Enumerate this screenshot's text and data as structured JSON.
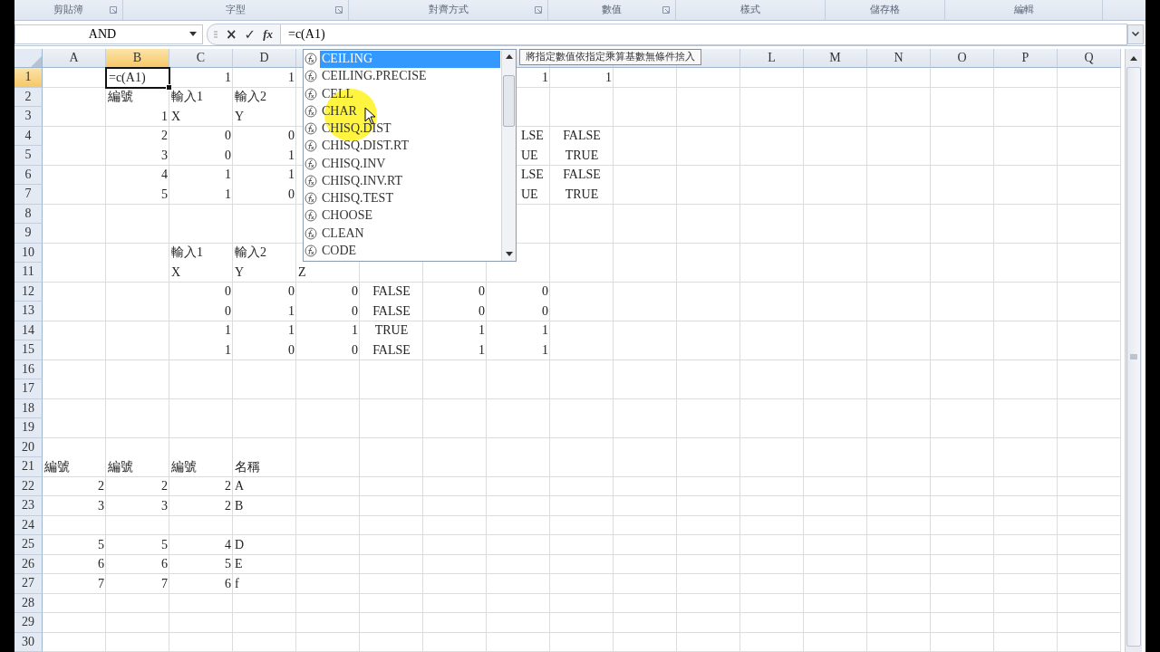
{
  "ribbon_groups": [
    {
      "label": "剪貼簿",
      "launcher": true
    },
    {
      "label": "字型",
      "launcher": true
    },
    {
      "label": "對齊方式",
      "launcher": true
    },
    {
      "label": "數值",
      "launcher": true
    },
    {
      "label": "樣式",
      "launcher": false
    },
    {
      "label": "儲存格",
      "launcher": false
    },
    {
      "label": "編輯",
      "launcher": false
    }
  ],
  "formula_bar": {
    "name_box": "AND",
    "cancel": "×",
    "enter": "✓",
    "fx": "fx",
    "formula": "=c(A1)"
  },
  "column_headers_left": [
    {
      "label": "A",
      "selected": false
    },
    {
      "label": "B",
      "selected": true
    },
    {
      "label": "C",
      "selected": false
    },
    {
      "label": "D",
      "selected": false
    }
  ],
  "column_headers_right": [
    {
      "label": "L",
      "selected": false
    },
    {
      "label": "M",
      "selected": false
    },
    {
      "label": "N",
      "selected": false
    },
    {
      "label": "O",
      "selected": false
    },
    {
      "label": "P",
      "selected": false
    },
    {
      "label": "Q",
      "selected": false
    }
  ],
  "rows": [
    {
      "header": "1",
      "selected": true,
      "cells": [
        null,
        {
          "text": "=c(A1)",
          "kind": "text",
          "selected": true
        },
        {
          "text": "1",
          "kind": "number",
          "selected": false
        },
        {
          "text": "1",
          "kind": "number",
          "selected": false
        },
        null,
        null,
        null,
        {
          "text": "1",
          "kind": "number",
          "selected": false
        },
        {
          "text": "1",
          "kind": "number",
          "selected": false
        }
      ]
    },
    {
      "header": "2",
      "selected": false,
      "cells": [
        null,
        {
          "text": "編號",
          "kind": "text",
          "selected": false
        },
        {
          "text": "輸入1",
          "kind": "text",
          "selected": false
        },
        {
          "text": "輸入2",
          "kind": "text",
          "selected": false
        }
      ]
    },
    {
      "header": "3",
      "selected": false,
      "cells": [
        null,
        {
          "text": "1",
          "kind": "number",
          "selected": false
        },
        {
          "text": "X",
          "kind": "text",
          "selected": false
        },
        {
          "text": "Y",
          "kind": "text",
          "selected": false
        }
      ]
    },
    {
      "header": "4",
      "selected": false,
      "cells": [
        null,
        {
          "text": "2",
          "kind": "number",
          "selected": false
        },
        {
          "text": "0",
          "kind": "number",
          "selected": false
        },
        {
          "text": "0",
          "kind": "number",
          "selected": false
        },
        null,
        null,
        null,
        {
          "text": "LSE",
          "kind": "partial",
          "selected": false
        },
        {
          "text": "FALSE",
          "kind": "bool",
          "selected": false
        }
      ]
    },
    {
      "header": "5",
      "selected": false,
      "cells": [
        null,
        {
          "text": "3",
          "kind": "number",
          "selected": false
        },
        {
          "text": "0",
          "kind": "number",
          "selected": false
        },
        {
          "text": "1",
          "kind": "number",
          "selected": false
        },
        null,
        null,
        null,
        {
          "text": "UE",
          "kind": "partial",
          "selected": false
        },
        {
          "text": "TRUE",
          "kind": "bool",
          "selected": false
        }
      ]
    },
    {
      "header": "6",
      "selected": false,
      "cells": [
        null,
        {
          "text": "4",
          "kind": "number",
          "selected": false
        },
        {
          "text": "1",
          "kind": "number",
          "selected": false
        },
        {
          "text": "1",
          "kind": "number",
          "selected": false
        },
        null,
        null,
        null,
        {
          "text": "LSE",
          "kind": "partial",
          "selected": false
        },
        {
          "text": "FALSE",
          "kind": "bool",
          "selected": false
        }
      ]
    },
    {
      "header": "7",
      "selected": false,
      "cells": [
        null,
        {
          "text": "5",
          "kind": "number",
          "selected": false
        },
        {
          "text": "1",
          "kind": "number",
          "selected": false
        },
        {
          "text": "0",
          "kind": "number",
          "selected": false
        },
        null,
        null,
        null,
        {
          "text": "UE",
          "kind": "partial",
          "selected": false
        },
        {
          "text": "TRUE",
          "kind": "bool",
          "selected": false
        }
      ]
    },
    {
      "header": "8",
      "selected": false,
      "cells": []
    },
    {
      "header": "9",
      "selected": false,
      "cells": []
    },
    {
      "header": "10",
      "selected": false,
      "cells": [
        null,
        null,
        {
          "text": "輸入1",
          "kind": "text",
          "selected": false
        },
        {
          "text": "輸入2",
          "kind": "text",
          "selected": false
        }
      ]
    },
    {
      "header": "11",
      "selected": false,
      "cells": [
        null,
        null,
        {
          "text": "X",
          "kind": "text",
          "selected": false
        },
        {
          "text": "Y",
          "kind": "text",
          "selected": false
        },
        {
          "text": "Z",
          "kind": "text",
          "selected": false
        }
      ]
    },
    {
      "header": "12",
      "selected": false,
      "cells": [
        null,
        null,
        {
          "text": "0",
          "kind": "number",
          "selected": false
        },
        {
          "text": "0",
          "kind": "number",
          "selected": false
        },
        {
          "text": "0",
          "kind": "number",
          "selected": false
        },
        {
          "text": "FALSE",
          "kind": "bool",
          "selected": false
        },
        {
          "text": "0",
          "kind": "number",
          "selected": false
        },
        {
          "text": "0",
          "kind": "number",
          "selected": false
        }
      ]
    },
    {
      "header": "13",
      "selected": false,
      "cells": [
        null,
        null,
        {
          "text": "0",
          "kind": "number",
          "selected": false
        },
        {
          "text": "1",
          "kind": "number",
          "selected": false
        },
        {
          "text": "0",
          "kind": "number",
          "selected": false
        },
        {
          "text": "FALSE",
          "kind": "bool",
          "selected": false
        },
        {
          "text": "0",
          "kind": "number",
          "selected": false
        },
        {
          "text": "0",
          "kind": "number",
          "selected": false
        }
      ]
    },
    {
      "header": "14",
      "selected": false,
      "cells": [
        null,
        null,
        {
          "text": "1",
          "kind": "number",
          "selected": false
        },
        {
          "text": "1",
          "kind": "number",
          "selected": false
        },
        {
          "text": "1",
          "kind": "number",
          "selected": false
        },
        {
          "text": "TRUE",
          "kind": "bool",
          "selected": false
        },
        {
          "text": "1",
          "kind": "number",
          "selected": false
        },
        {
          "text": "1",
          "kind": "number",
          "selected": false
        }
      ]
    },
    {
      "header": "15",
      "selected": false,
      "cells": [
        null,
        null,
        {
          "text": "1",
          "kind": "number",
          "selected": false
        },
        {
          "text": "0",
          "kind": "number",
          "selected": false
        },
        {
          "text": "0",
          "kind": "number",
          "selected": false
        },
        {
          "text": "FALSE",
          "kind": "bool",
          "selected": false
        },
        {
          "text": "1",
          "kind": "number",
          "selected": false
        },
        {
          "text": "1",
          "kind": "number",
          "selected": false
        }
      ]
    },
    {
      "header": "16",
      "selected": false,
      "cells": []
    },
    {
      "header": "17",
      "selected": false,
      "cells": []
    },
    {
      "header": "18",
      "selected": false,
      "cells": []
    },
    {
      "header": "19",
      "selected": false,
      "cells": []
    },
    {
      "header": "20",
      "selected": false,
      "cells": []
    },
    {
      "header": "21",
      "selected": false,
      "cells": [
        {
          "text": "編號",
          "kind": "text",
          "selected": false
        },
        {
          "text": "編號",
          "kind": "text",
          "selected": false
        },
        {
          "text": "編號",
          "kind": "text",
          "selected": false
        },
        {
          "text": "名稱",
          "kind": "text",
          "selected": false
        }
      ]
    },
    {
      "header": "22",
      "selected": false,
      "cells": [
        {
          "text": "2",
          "kind": "number",
          "selected": false
        },
        {
          "text": "2",
          "kind": "number",
          "selected": false
        },
        {
          "text": "2",
          "kind": "number",
          "selected": false
        },
        {
          "text": "A",
          "kind": "text",
          "selected": false
        }
      ]
    },
    {
      "header": "23",
      "selected": false,
      "cells": [
        {
          "text": "3",
          "kind": "number",
          "selected": false
        },
        {
          "text": "3",
          "kind": "number",
          "selected": false
        },
        {
          "text": "2",
          "kind": "number",
          "selected": false
        },
        {
          "text": "B",
          "kind": "text",
          "selected": false
        }
      ]
    },
    {
      "header": "24",
      "selected": false,
      "cells": []
    },
    {
      "header": "25",
      "selected": false,
      "cells": [
        {
          "text": "5",
          "kind": "number",
          "selected": false
        },
        {
          "text": "5",
          "kind": "number",
          "selected": false
        },
        {
          "text": "4",
          "kind": "number",
          "selected": false
        },
        {
          "text": "D",
          "kind": "text",
          "selected": false
        }
      ]
    },
    {
      "header": "26",
      "selected": false,
      "cells": [
        {
          "text": "6",
          "kind": "number",
          "selected": false
        },
        {
          "text": "6",
          "kind": "number",
          "selected": false
        },
        {
          "text": "5",
          "kind": "number",
          "selected": false
        },
        {
          "text": "E",
          "kind": "text",
          "selected": false
        }
      ]
    },
    {
      "header": "27",
      "selected": false,
      "cells": [
        {
          "text": "7",
          "kind": "number",
          "selected": false
        },
        {
          "text": "7",
          "kind": "number",
          "selected": false
        },
        {
          "text": "6",
          "kind": "number",
          "selected": false
        },
        {
          "text": "f",
          "kind": "text",
          "selected": false
        }
      ]
    },
    {
      "header": "28",
      "selected": false,
      "cells": []
    },
    {
      "header": "29",
      "selected": false,
      "cells": []
    },
    {
      "header": "30",
      "selected": false,
      "cells": []
    }
  ],
  "autocomplete": {
    "items": [
      {
        "label": "CEILING",
        "selected": true
      },
      {
        "label": "CEILING.PRECISE",
        "selected": false
      },
      {
        "label": "CELL",
        "selected": false
      },
      {
        "label": "CHAR",
        "selected": false
      },
      {
        "label": "CHISQ.DIST",
        "selected": false
      },
      {
        "label": "CHISQ.DIST.RT",
        "selected": false
      },
      {
        "label": "CHISQ.INV",
        "selected": false
      },
      {
        "label": "CHISQ.INV.RT",
        "selected": false
      },
      {
        "label": "CHISQ.TEST",
        "selected": false
      },
      {
        "label": "CHOOSE",
        "selected": false
      },
      {
        "label": "CLEAN",
        "selected": false
      },
      {
        "label": "CODE",
        "selected": false
      }
    ],
    "tooltip": "將指定數值依指定乘算基數無條件捨入"
  }
}
